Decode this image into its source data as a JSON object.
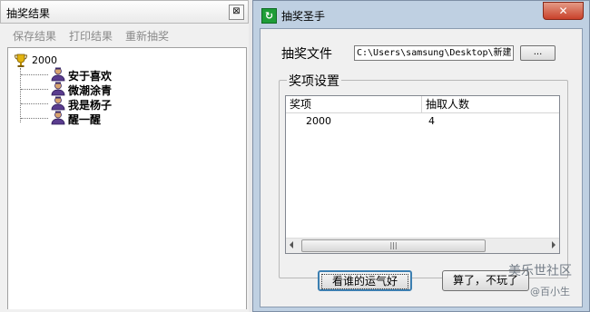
{
  "results_panel": {
    "title": "抽奖结果",
    "close_glyph": "⊠",
    "menu": [
      "保存结果",
      "打印结果",
      "重新抽奖"
    ],
    "tree": {
      "root": "2000",
      "children": [
        "安于喜欢",
        "微潮涂青",
        "我是杨子",
        "醒一醒"
      ]
    }
  },
  "main_window": {
    "title": "抽奖圣手",
    "close_glyph": "✕",
    "file_label": "抽奖文件",
    "file_path": "C:\\Users\\samsung\\Desktop\\新建",
    "browse_label": "...",
    "prize_group": {
      "legend": "奖项设置",
      "columns": [
        "奖项",
        "抽取人数"
      ],
      "rows": [
        [
          "2000",
          "4"
        ]
      ]
    },
    "draw_button": "看谁的运气好",
    "quit_button": "算了，不玩了"
  },
  "watermark": {
    "line1": "美乐世社区",
    "line2": "@百小生"
  },
  "colors": {
    "accent": "#3c7fb1",
    "close_red": "#c9412a",
    "window_frame": "#bfd0e2"
  }
}
